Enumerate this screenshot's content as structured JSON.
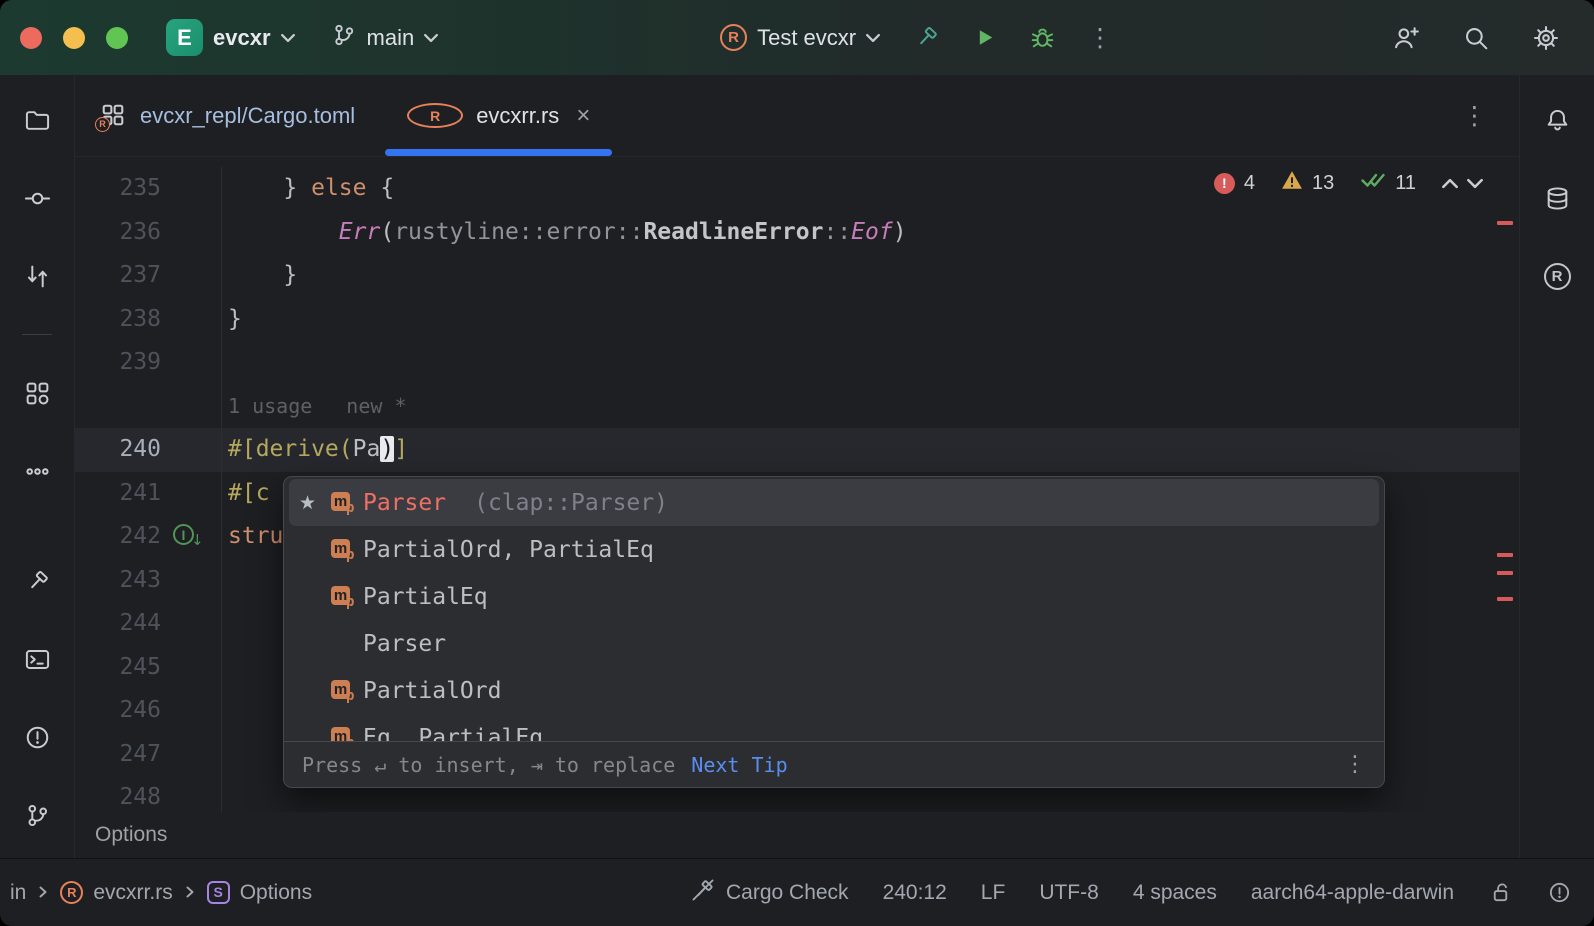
{
  "colors": {
    "accent": "#3574f0",
    "rust_orange": "#e8815a",
    "error_red": "#d85b5b",
    "warning_yellow": "#d9a84c",
    "ok_green": "#5fad65"
  },
  "icons": {
    "star": "★",
    "kebab": "⋮",
    "close": "×",
    "rust_letter": "R",
    "struct_letter": "S",
    "error_bang": "!",
    "impl_letter": "I",
    "impl_arrow": "↓",
    "macro_letter": "m",
    "macro_sub": "p"
  },
  "titlebar": {
    "project_badge": "E",
    "project_name": "evcxr",
    "branch_name": "main",
    "run_config": "Test evcxr"
  },
  "tabbar": {
    "tabs": [
      {
        "label": "evcxr_repl/Cargo.toml",
        "active": false
      },
      {
        "label": "evcxrr.rs",
        "active": true
      }
    ]
  },
  "inspections": {
    "errors": "4",
    "warnings": "13",
    "passed": "11"
  },
  "editor": {
    "lines": [
      {
        "n": "235",
        "segs": [
          {
            "t": "    } "
          },
          {
            "t": "else",
            "c": "kw"
          },
          {
            "t": " {"
          }
        ]
      },
      {
        "n": "236",
        "segs": [
          {
            "t": "        "
          },
          {
            "t": "Err",
            "c": "enm"
          },
          {
            "t": "("
          },
          {
            "t": "rustyline::error::",
            "c": "path"
          },
          {
            "t": "ReadlineError",
            "c": "typ"
          },
          {
            "t": "::",
            "c": "path"
          },
          {
            "t": "Eof",
            "c": "enm"
          },
          {
            "t": ")"
          }
        ]
      },
      {
        "n": "237",
        "segs": [
          {
            "t": "    }"
          }
        ]
      },
      {
        "n": "238",
        "segs": [
          {
            "t": "}"
          }
        ]
      },
      {
        "n": "239",
        "segs": []
      },
      {
        "hint": true,
        "hints": [
          "1 usage",
          "new *"
        ]
      },
      {
        "n": "240",
        "current": true,
        "segs": [
          {
            "t": "#[derive(",
            "c": "attr"
          },
          {
            "t": "Pa"
          },
          {
            "t": ")",
            "c": "caret"
          },
          {
            "t": "]",
            "c": "attr"
          }
        ]
      },
      {
        "n": "241",
        "segs": [
          {
            "t": "#[c",
            "c": "attr"
          }
        ]
      },
      {
        "n": "242",
        "gutter_icon": "implementation",
        "segs": [
          {
            "t": "stru",
            "c": "kw"
          }
        ]
      },
      {
        "n": "243",
        "segs": []
      },
      {
        "n": "244",
        "segs": []
      },
      {
        "n": "245",
        "segs": []
      },
      {
        "n": "246",
        "segs": []
      },
      {
        "n": "247",
        "segs": []
      },
      {
        "n": "248",
        "segs": []
      }
    ]
  },
  "completion": {
    "items": [
      {
        "label": "Parser",
        "detail": "(clap::Parser)",
        "icon": "macro",
        "starred": true,
        "selected": true,
        "highlight": true
      },
      {
        "label": "PartialOrd, PartialEq",
        "icon": "macro"
      },
      {
        "label": "PartialEq",
        "icon": "macro"
      },
      {
        "label": "Parser",
        "icon": "none"
      },
      {
        "label": "PartialOrd",
        "icon": "macro"
      },
      {
        "label": "Eq, PartialEq",
        "icon": "macro"
      }
    ],
    "footer": {
      "hint": "Press ↵ to insert, ⇥ to replace",
      "action": "Next Tip"
    }
  },
  "breadcrumbs": {
    "current": "Options"
  },
  "statusbar": {
    "crumb_module": "in",
    "crumb_file": "evcxrr.rs",
    "crumb_symbol": "Options",
    "cargo_check": "Cargo Check",
    "caret_position": "240:12",
    "line_ending": "LF",
    "encoding": "UTF-8",
    "indent": "4 spaces",
    "target": "aarch64-apple-darwin"
  }
}
